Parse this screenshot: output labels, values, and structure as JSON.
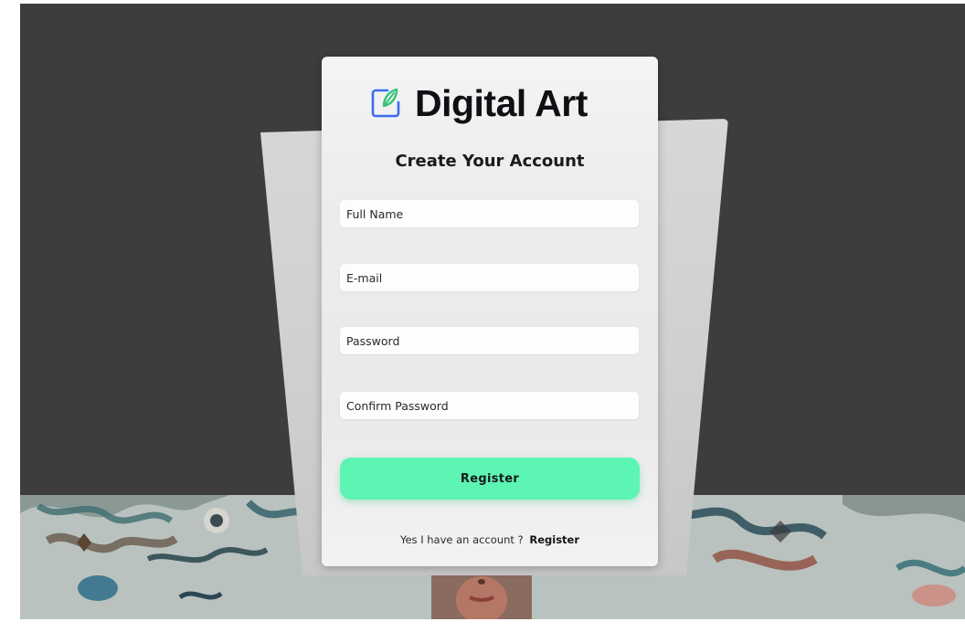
{
  "brand": {
    "name": "Digital Art",
    "icon": "edit-pen-icon",
    "icon_color": "#3b6cf0",
    "leaf_color": "#34c37a"
  },
  "form": {
    "title": "Create Your Account",
    "fields": {
      "full_name": {
        "placeholder": "Full Name"
      },
      "email": {
        "placeholder": "E-mail"
      },
      "password": {
        "placeholder": "Password"
      },
      "confirm_password": {
        "placeholder": "Confirm Password"
      }
    },
    "submit_label": "Register",
    "submit_color": "#5cf5b4"
  },
  "footer": {
    "prompt_start": "Yes I have",
    "prompt_end": "an account ?",
    "link_label": "Register"
  },
  "colors": {
    "page_background": "#3d3d3d",
    "card_background": "#efefef"
  }
}
